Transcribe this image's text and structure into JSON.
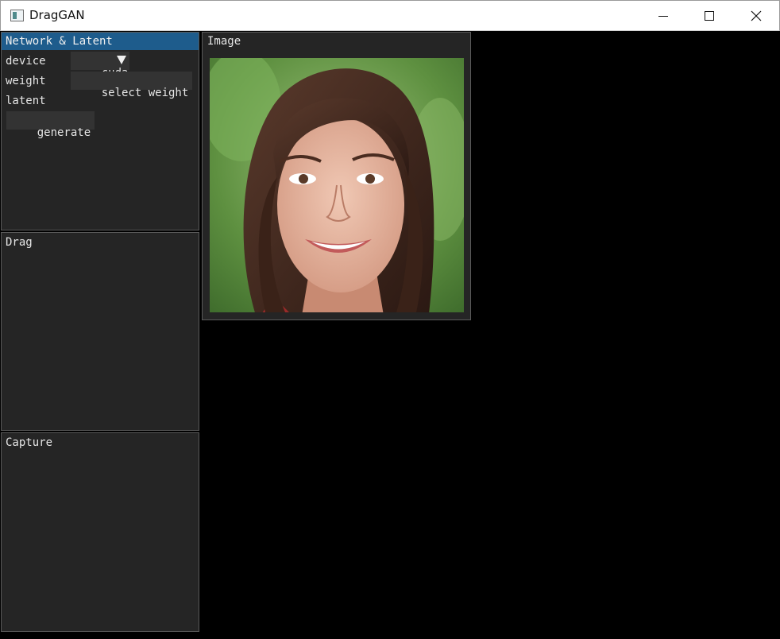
{
  "window": {
    "title": "DragGAN"
  },
  "network_panel": {
    "title": "Network & Latent",
    "device_label": "device",
    "device_value": "cuda",
    "weight_label": "weight",
    "weight_button": "select weight",
    "latent_label": "latent",
    "generate_button": "generate"
  },
  "drag_panel": {
    "title": "Drag"
  },
  "capture_panel": {
    "title": "Capture"
  },
  "image_panel": {
    "title": "Image"
  },
  "colors": {
    "active_header": "#1e5c8c",
    "panel_bg": "#252525",
    "widget_bg": "#333333",
    "background": "#000000"
  }
}
